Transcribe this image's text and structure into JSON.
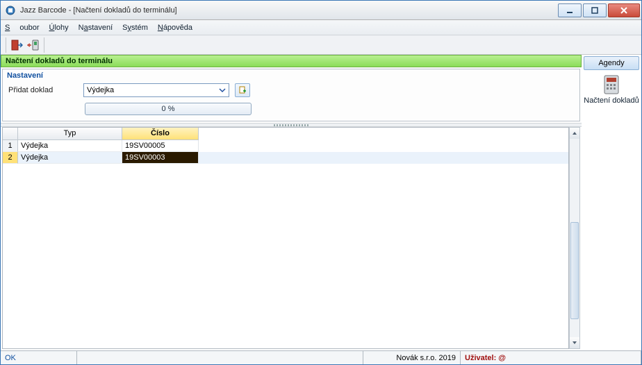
{
  "window": {
    "title": "Jazz Barcode - [Načtení dokladů do terminálu]"
  },
  "menu": {
    "soubor": "Soubor",
    "ulohy": "Úlohy",
    "nastaveni": "Nastavení",
    "system": "Systém",
    "napoveda": "Nápověda"
  },
  "page_header": "Načtení dokladů do terminálu",
  "settings": {
    "title": "Nastavení",
    "add_doc_label": "Přidat doklad",
    "combo_value": "Výdejka",
    "progress_text": "0 %"
  },
  "grid": {
    "columns": {
      "typ": "Typ",
      "cislo": "Číslo"
    },
    "rows": [
      {
        "n": "1",
        "typ": "Výdejka",
        "cislo": "19SV00005"
      },
      {
        "n": "2",
        "typ": "Výdejka",
        "cislo": "19SV00003"
      }
    ]
  },
  "right": {
    "agendy": "Agendy",
    "item_label": "Načtení dokladů"
  },
  "status": {
    "ok": "OK",
    "company": "Novák s.r.o. 2019",
    "user_label": "Uživatel: @"
  }
}
